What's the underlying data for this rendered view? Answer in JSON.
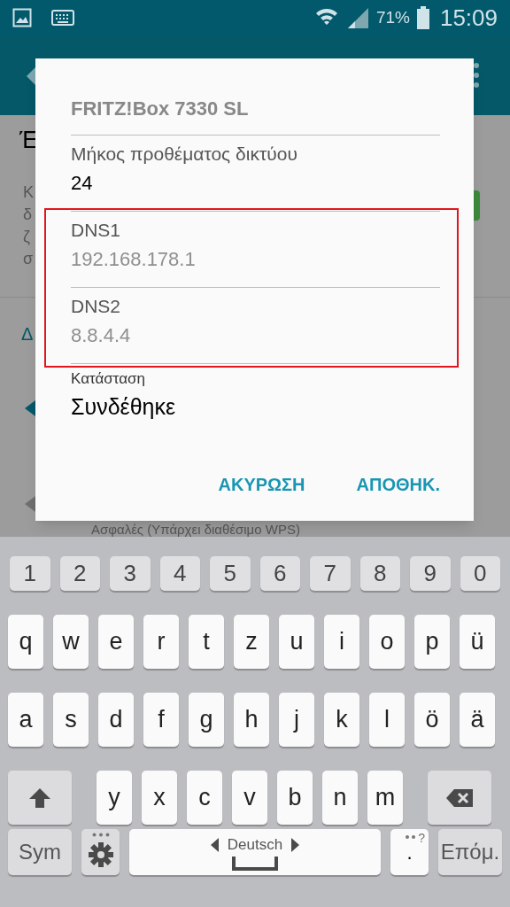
{
  "status_bar": {
    "battery": "71%",
    "time": "15:09"
  },
  "background": {
    "fragments": [
      {
        "kind": "title",
        "text": "Έ"
      },
      {
        "kind": "line",
        "text": "Κ"
      },
      {
        "kind": "line",
        "text": "δ"
      },
      {
        "kind": "line",
        "text": "ζ"
      },
      {
        "kind": "line",
        "text": "σ"
      },
      {
        "kind": "section",
        "text": "Δ"
      }
    ],
    "toggle_on": true,
    "network_subtitle": "Ασφαλές (Υπάρχει διαθέσιμο WPS)"
  },
  "dialog": {
    "title": "FRITZ!Box 7330 SL",
    "fields": [
      {
        "label": "Μήκος προθέματος δικτύου",
        "value": "24",
        "kind": "text"
      },
      {
        "label": "DNS1",
        "placeholder": "192.168.178.1",
        "kind": "hint"
      },
      {
        "label": "DNS2",
        "placeholder": "8.8.4.4",
        "kind": "hint"
      }
    ],
    "status": {
      "label": "Κατάσταση",
      "value": "Συνδέθηκε"
    },
    "buttons": [
      "ΑΚΥΡΩΣΗ",
      "ΑΠΟΘΗΚ."
    ]
  },
  "keyboard": {
    "number_row": [
      {
        "kind": "number",
        "label": "1"
      },
      {
        "kind": "number",
        "label": "2"
      },
      {
        "kind": "number",
        "label": "3"
      },
      {
        "kind": "number",
        "label": "4"
      },
      {
        "kind": "number",
        "label": "5"
      },
      {
        "kind": "number",
        "label": "6"
      },
      {
        "kind": "number",
        "label": "7"
      },
      {
        "kind": "number",
        "label": "8"
      },
      {
        "kind": "number",
        "label": "9"
      },
      {
        "kind": "number",
        "label": "0"
      }
    ],
    "letter_rows": [
      [
        {
          "kind": "char",
          "label": "q"
        },
        {
          "kind": "char",
          "label": "w"
        },
        {
          "kind": "char",
          "label": "e"
        },
        {
          "kind": "char",
          "label": "r"
        },
        {
          "kind": "char",
          "label": "t"
        },
        {
          "kind": "char",
          "label": "z"
        },
        {
          "kind": "char",
          "label": "u"
        },
        {
          "kind": "char",
          "label": "i"
        },
        {
          "kind": "char",
          "label": "o"
        },
        {
          "kind": "char",
          "label": "p"
        },
        {
          "kind": "char",
          "label": "ü"
        }
      ],
      [
        {
          "kind": "char",
          "label": "a"
        },
        {
          "kind": "char",
          "label": "s"
        },
        {
          "kind": "char",
          "label": "d"
        },
        {
          "kind": "char",
          "label": "f"
        },
        {
          "kind": "char",
          "label": "g"
        },
        {
          "kind": "char",
          "label": "h"
        },
        {
          "kind": "char",
          "label": "j"
        },
        {
          "kind": "char",
          "label": "k"
        },
        {
          "kind": "char",
          "label": "l"
        },
        {
          "kind": "char",
          "label": "ö"
        },
        {
          "kind": "char",
          "label": "ä"
        }
      ],
      [
        {
          "kind": "shift"
        },
        {
          "kind": "char",
          "label": "y"
        },
        {
          "kind": "char",
          "label": "x"
        },
        {
          "kind": "char",
          "label": "c"
        },
        {
          "kind": "char",
          "label": "v"
        },
        {
          "kind": "char",
          "label": "b"
        },
        {
          "kind": "char",
          "label": "n"
        },
        {
          "kind": "char",
          "label": "m"
        },
        {
          "kind": "backspace"
        }
      ]
    ],
    "bottom_row": [
      {
        "kind": "function",
        "label": "Sym"
      },
      {
        "kind": "settings"
      },
      {
        "kind": "space",
        "label": "Deutsch"
      },
      {
        "kind": "period",
        "label": ".",
        "hint": "?"
      },
      {
        "kind": "function",
        "label": "Επόμ."
      }
    ]
  }
}
